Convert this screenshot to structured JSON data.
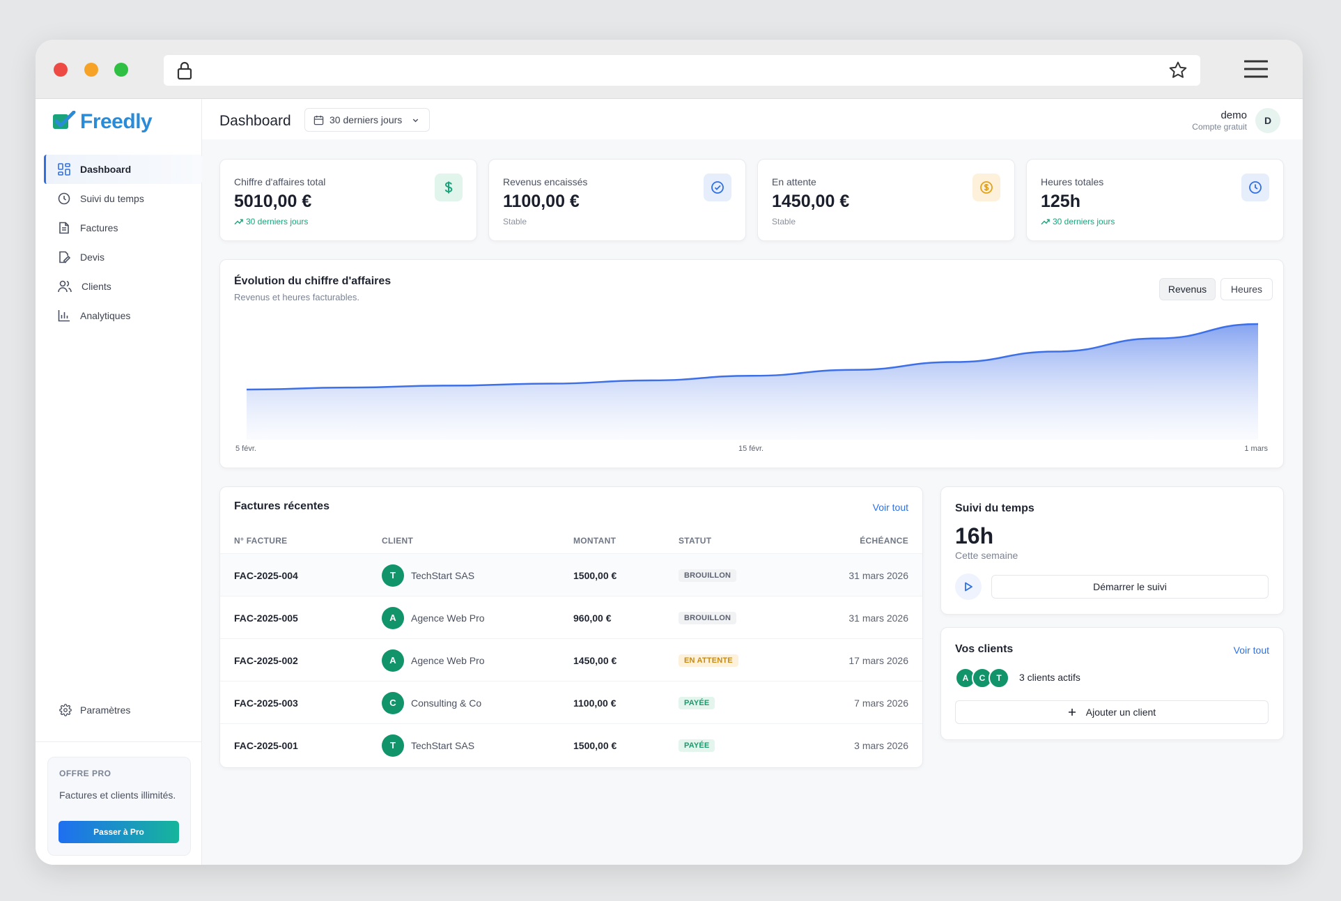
{
  "brand": {
    "name": "Freedly",
    "logo_color": "#2a8cd8",
    "accent": "#2f6fe4",
    "success": "#11946a"
  },
  "sidebar": {
    "items": [
      {
        "label": "Dashboard",
        "icon": "grid-icon",
        "active": true
      },
      {
        "label": "Suivi du temps",
        "icon": "clock-icon"
      },
      {
        "label": "Factures",
        "icon": "file-icon"
      },
      {
        "label": "Devis",
        "icon": "edit-document-icon"
      },
      {
        "label": "Clients",
        "icon": "users-icon"
      },
      {
        "label": "Analytiques",
        "icon": "bar-chart-icon"
      }
    ],
    "settings_label": "Paramètres",
    "pro": {
      "label": "OFFRE PRO",
      "text": "Factures et clients illimités.",
      "button": "Passer à Pro"
    }
  },
  "header": {
    "title": "Dashboard",
    "range": "30 derniers jours",
    "user": {
      "name": "demo",
      "plan": "Compte gratuit",
      "initial": "D"
    }
  },
  "stats": [
    {
      "label": "Chiffre d'affaires total",
      "value": "5010,00 €",
      "sub": "30 derniers jours",
      "trend": "up",
      "icon": "dollar-icon",
      "icon_bg": "#e1f5ec",
      "icon_color": "#1aa37a"
    },
    {
      "label": "Revenus encaissés",
      "value": "1100,00 €",
      "sub": "Stable",
      "trend": "flat",
      "icon": "check-circle-icon",
      "icon_bg": "#e6eefc",
      "icon_color": "#2f6fe4"
    },
    {
      "label": "En attente",
      "value": "1450,00 €",
      "sub": "Stable",
      "trend": "flat",
      "icon": "coin-icon",
      "icon_bg": "#fdf1dc",
      "icon_color": "#e3a21a"
    },
    {
      "label": "Heures totales",
      "value": "125h",
      "sub": "30 derniers jours",
      "trend": "up",
      "icon": "clock-icon",
      "icon_bg": "#e6eefc",
      "icon_color": "#2f6fe4"
    }
  ],
  "chart": {
    "title": "Évolution du chiffre d'affaires",
    "subtitle": "Revenus et heures facturables.",
    "toggles": [
      {
        "label": "Revenus",
        "active": true
      },
      {
        "label": "Heures",
        "active": false
      }
    ]
  },
  "chart_data": {
    "type": "area",
    "title": "Évolution du chiffre d'affaires",
    "subtitle": "Revenus et heures facturables.",
    "x_ticks": [
      "5 févr.",
      "15 févr.",
      "1 mars"
    ],
    "x": [
      0,
      0.1,
      0.2,
      0.3,
      0.4,
      0.5,
      0.6,
      0.7,
      0.8,
      0.9,
      1.0
    ],
    "series": [
      {
        "values": [
          0.0,
          0.03,
          0.06,
          0.09,
          0.14,
          0.21,
          0.3,
          0.42,
          0.58,
          0.78,
          1.0
        ],
        "color": "#3d6fe6"
      }
    ],
    "grid": false,
    "legend": "none"
  },
  "invoices": {
    "title": "Factures récentes",
    "see_all": "Voir tout",
    "columns": [
      "N° FACTURE",
      "CLIENT",
      "MONTANT",
      "STATUT",
      "ÉCHÉANCE"
    ],
    "rows": [
      {
        "id": "FAC-2025-004",
        "initial": "T",
        "client": "TechStart SAS",
        "amount": "1500,00 €",
        "status": "BROUILLON",
        "status_kind": "draft",
        "due": "31 mars 2026"
      },
      {
        "id": "FAC-2025-005",
        "initial": "A",
        "client": "Agence Web Pro",
        "amount": "960,00 €",
        "status": "BROUILLON",
        "status_kind": "draft",
        "due": "31 mars 2026"
      },
      {
        "id": "FAC-2025-002",
        "initial": "A",
        "client": "Agence Web Pro",
        "amount": "1450,00 €",
        "status": "EN ATTENTE",
        "status_kind": "pending",
        "due": "17 mars 2026"
      },
      {
        "id": "FAC-2025-003",
        "initial": "C",
        "client": "Consulting & Co",
        "amount": "1100,00 €",
        "status": "PAYÉE",
        "status_kind": "paid",
        "due": "7 mars 2026"
      },
      {
        "id": "FAC-2025-001",
        "initial": "T",
        "client": "TechStart SAS",
        "amount": "1500,00 €",
        "status": "PAYÉE",
        "status_kind": "paid",
        "due": "3 mars 2026"
      }
    ]
  },
  "time_tracking": {
    "title": "Suivi du temps",
    "value": "16h",
    "sub": "Cette semaine",
    "button": "Démarrer le suivi"
  },
  "clients": {
    "title": "Vos clients",
    "see_all": "Voir tout",
    "initials": [
      "A",
      "C",
      "T"
    ],
    "active": "3 clients actifs",
    "add_button": "Ajouter un client"
  }
}
